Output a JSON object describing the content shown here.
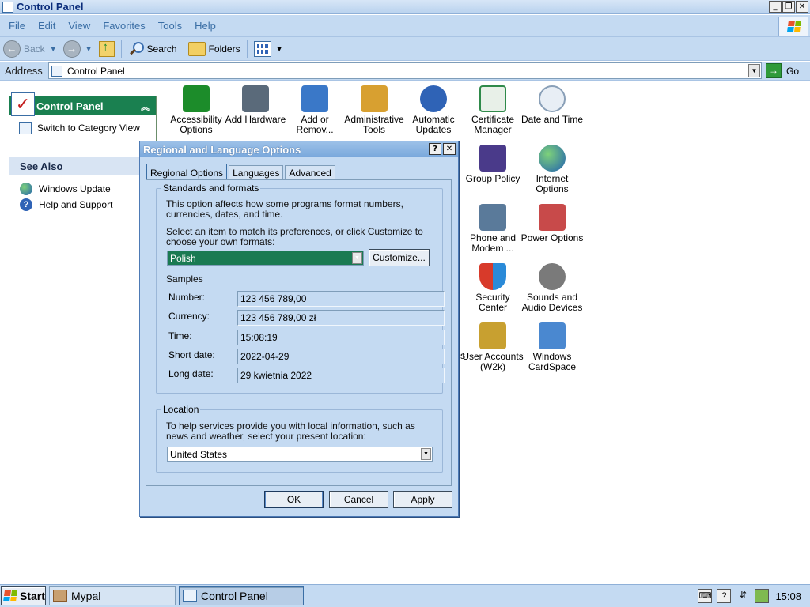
{
  "window": {
    "title": "Control Panel",
    "controls": [
      "_",
      "❐",
      "✕"
    ]
  },
  "menu": [
    "File",
    "Edit",
    "View",
    "Favorites",
    "Tools",
    "Help"
  ],
  "toolbar": {
    "back": "Back",
    "search": "Search",
    "folders": "Folders"
  },
  "address": {
    "label": "Address",
    "value": "Control Panel",
    "go": "Go"
  },
  "sidebar": {
    "control_panel": {
      "title": "Control Panel",
      "link": "Switch to Category View"
    },
    "see_also": {
      "title": "See Also",
      "links": [
        "Windows Update",
        "Help and Support"
      ]
    }
  },
  "applets": [
    {
      "label": "Accessibility Options",
      "icon": "accessibility-icon",
      "color": "#1c8c2a"
    },
    {
      "label": "Add Hardware",
      "icon": "hardware-icon",
      "color": "#5a6a7a"
    },
    {
      "label": "Add or Remov...",
      "icon": "add-remove-icon",
      "color": "#3a78c8"
    },
    {
      "label": "Administrative Tools",
      "icon": "admin-tools-icon",
      "color": "#d8a030"
    },
    {
      "label": "Automatic Updates",
      "icon": "updates-icon",
      "color": "#2f63b6"
    },
    {
      "label": "Certificate Manager",
      "icon": "certificate-icon",
      "color": "#2f8a4a"
    },
    {
      "label": "Date and Time",
      "icon": "clock-icon",
      "color": "#8aa0b8"
    },
    {
      "label": "Group Policy",
      "icon": "group-policy-icon",
      "color": "#4a3a8a"
    },
    {
      "label": "Internet Options",
      "icon": "internet-icon",
      "color": "#3aa04a"
    },
    {
      "label": "Phone and Modem ...",
      "icon": "phone-icon",
      "color": "#5a7a9a"
    },
    {
      "label": "Power Options",
      "icon": "power-icon",
      "color": "#c84a4a"
    },
    {
      "label": "Security Center",
      "icon": "security-shield-icon",
      "color": "#d8a020"
    },
    {
      "label": "Sounds and Audio Devices",
      "icon": "speaker-icon",
      "color": "#7a7a7a"
    },
    {
      "label": "s",
      "icon": "",
      "color": ""
    },
    {
      "label": "User Accounts (W2k)",
      "icon": "user-accounts-icon",
      "color": "#c8a030"
    },
    {
      "label": "Windows CardSpace",
      "icon": "cardspace-icon",
      "color": "#4a88d0"
    }
  ],
  "dialog": {
    "title": "Regional and Language Options",
    "help": "?",
    "close": "✕",
    "tabs": [
      "Regional Options",
      "Languages",
      "Advanced"
    ],
    "standards": {
      "title": "Standards and formats",
      "desc1": "This option affects how some programs format numbers, currencies, dates, and time.",
      "desc2": "Select an item to match its preferences, or click Customize to choose your own formats:",
      "selected": "Polish",
      "customize": "Customize..."
    },
    "samples": {
      "title": "Samples",
      "number_label": "Number:",
      "number": "123 456 789,00",
      "currency_label": "Currency:",
      "currency": "123 456 789,00 zł",
      "time_label": "Time:",
      "time": "15:08:19",
      "short_date_label": "Short date:",
      "short_date": "2022-04-29",
      "long_date_label": "Long date:",
      "long_date": "29 kwietnia 2022"
    },
    "location": {
      "title": "Location",
      "desc": "To help services provide you with local information, such as news and weather, select your present location:",
      "value": "United States"
    },
    "buttons": {
      "ok": "OK",
      "cancel": "Cancel",
      "apply": "Apply"
    }
  },
  "taskbar": {
    "start": "Start",
    "tasks": [
      "Mypal",
      "Control Panel"
    ],
    "clock": "15:08"
  }
}
